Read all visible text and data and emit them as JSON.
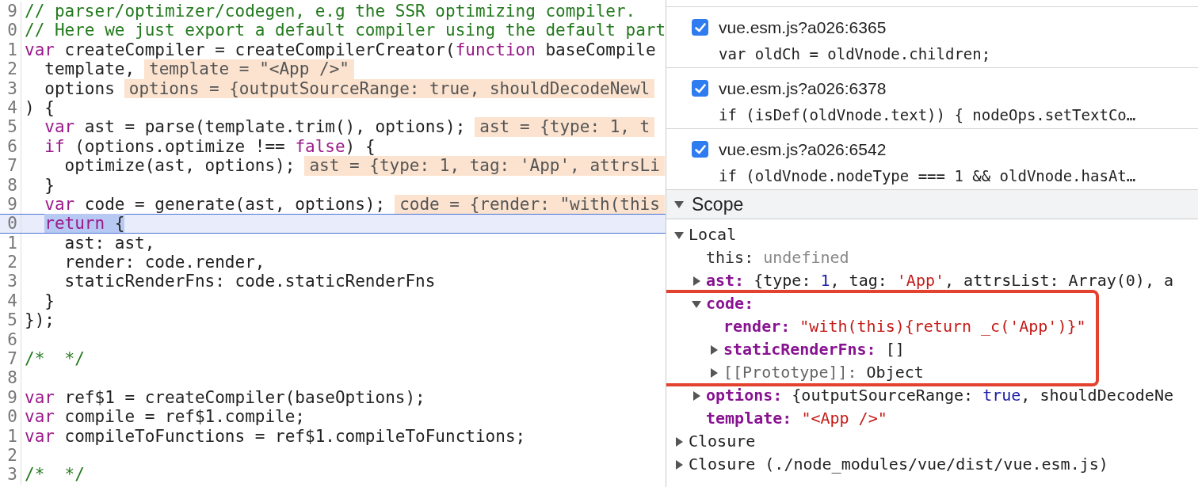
{
  "editor": {
    "lines": [
      {
        "number": "9",
        "current": false,
        "segments": [
          {
            "kind": "comment",
            "text": "// parser/optimizer/codegen, e.g the SSR optimizing compiler."
          }
        ]
      },
      {
        "number": "0",
        "current": false,
        "segments": [
          {
            "kind": "comment",
            "text": "// Here we just export a default compiler using the default part"
          }
        ]
      },
      {
        "number": "1",
        "current": false,
        "segments": [
          {
            "kind": "keyword",
            "text": "var"
          },
          {
            "kind": "plain",
            "text": " createCompiler = createCompilerCreator("
          },
          {
            "kind": "keyword",
            "text": "function"
          },
          {
            "kind": "plain",
            "text": " baseCompile"
          }
        ]
      },
      {
        "number": "2",
        "current": false,
        "segments": [
          {
            "kind": "plain",
            "text": "  template,"
          }
        ],
        "hint": "template = \"<App />\""
      },
      {
        "number": "3",
        "current": false,
        "segments": [
          {
            "kind": "plain",
            "text": "  options"
          }
        ],
        "hint": "options = {outputSourceRange: true, shouldDecodeNewl"
      },
      {
        "number": "4",
        "current": false,
        "segments": [
          {
            "kind": "plain",
            "text": ") {"
          }
        ]
      },
      {
        "number": "5",
        "current": false,
        "segments": [
          {
            "kind": "keyword",
            "text": "  var"
          },
          {
            "kind": "plain",
            "text": " ast = parse(template.trim(), options);"
          }
        ],
        "hint": "ast = {type: 1, t"
      },
      {
        "number": "6",
        "current": false,
        "segments": [
          {
            "kind": "keyword",
            "text": "  if"
          },
          {
            "kind": "plain",
            "text": " (options.optimize !== "
          },
          {
            "kind": "keyword",
            "text": "false"
          },
          {
            "kind": "plain",
            "text": ") {"
          }
        ]
      },
      {
        "number": "7",
        "current": false,
        "segments": [
          {
            "kind": "plain",
            "text": "    optimize(ast, options);"
          }
        ],
        "hint": "ast = {type: 1, tag: 'App', attrsLi"
      },
      {
        "number": "8",
        "current": false,
        "segments": [
          {
            "kind": "plain",
            "text": "  }"
          }
        ]
      },
      {
        "number": "9",
        "current": false,
        "segments": [
          {
            "kind": "keyword",
            "text": "  var"
          },
          {
            "kind": "plain",
            "text": " code = generate(ast, options);"
          }
        ],
        "hint": "code = {render: \"with(this"
      },
      {
        "number": "0",
        "current": true,
        "segments": [
          {
            "kind": "keyword",
            "text": "  return"
          },
          {
            "kind": "plain",
            "text": " {"
          }
        ]
      },
      {
        "number": "1",
        "current": false,
        "segments": [
          {
            "kind": "plain",
            "text": "    ast: ast,"
          }
        ]
      },
      {
        "number": "2",
        "current": false,
        "segments": [
          {
            "kind": "plain",
            "text": "    render: code.render,"
          }
        ]
      },
      {
        "number": "3",
        "current": false,
        "segments": [
          {
            "kind": "plain",
            "text": "    staticRenderFns: code.staticRenderFns"
          }
        ]
      },
      {
        "number": "4",
        "current": false,
        "segments": [
          {
            "kind": "plain",
            "text": "  }"
          }
        ]
      },
      {
        "number": "5",
        "current": false,
        "segments": [
          {
            "kind": "plain",
            "text": "});"
          }
        ]
      },
      {
        "number": "6",
        "current": false
      },
      {
        "number": "7",
        "current": false,
        "segments": [
          {
            "kind": "comment",
            "text": "/*  */"
          }
        ]
      },
      {
        "number": "8",
        "current": false
      },
      {
        "number": "9",
        "current": false,
        "segments": [
          {
            "kind": "keyword",
            "text": "var"
          },
          {
            "kind": "plain",
            "text": " ref$1 = createCompiler(baseOptions);"
          }
        ]
      },
      {
        "number": "0",
        "current": false,
        "segments": [
          {
            "kind": "keyword",
            "text": "var"
          },
          {
            "kind": "plain",
            "text": " compile = ref$1.compile;"
          }
        ]
      },
      {
        "number": "1",
        "current": false,
        "segments": [
          {
            "kind": "keyword",
            "text": "var"
          },
          {
            "kind": "plain",
            "text": " compileToFunctions = ref$1.compileToFunctions;"
          }
        ]
      },
      {
        "number": "2",
        "current": false
      },
      {
        "number": "3",
        "current": false,
        "segments": [
          {
            "kind": "comment",
            "text": "/*  */"
          }
        ]
      }
    ]
  },
  "breakpoints": [
    {
      "location": "vue.esm.js?a026:6365",
      "code": "var oldCh = oldVnode.children;",
      "checked": true
    },
    {
      "location": "vue.esm.js?a026:6378",
      "code": "if (isDef(oldVnode.text)) { nodeOps.setTextCo…",
      "checked": true
    },
    {
      "location": "vue.esm.js?a026:6542",
      "code": "if (oldVnode.nodeType === 1 && oldVnode.hasAt…",
      "checked": true
    }
  ],
  "scope": {
    "title": "Scope",
    "expanded": true,
    "nodes": [
      {
        "key": "Local",
        "kind": "group",
        "expanded": true,
        "boxed": false,
        "children": [
          {
            "key": "this:",
            "kind": "plain",
            "boxed": false,
            "value": [
              {
                "kind": "undefined",
                "text": "undefined"
              }
            ]
          },
          {
            "key": "ast:",
            "kind": "prop",
            "expanded": false,
            "boxed": false,
            "value": [
              {
                "kind": "plain",
                "text": "{type: "
              },
              {
                "kind": "number",
                "text": "1"
              },
              {
                "kind": "plain",
                "text": ", tag: "
              },
              {
                "kind": "string",
                "text": "'App'"
              },
              {
                "kind": "plain",
                "text": ", attrsList: Array(0), a"
              }
            ]
          },
          {
            "key": "code:",
            "kind": "prop",
            "expanded": true,
            "boxed": true,
            "children": [
              {
                "key": "render:",
                "kind": "prop",
                "boxed": false,
                "value": [
                  {
                    "kind": "string",
                    "text": "\"with(this){return _c('App')}\""
                  }
                ]
              },
              {
                "key": "staticRenderFns:",
                "kind": "prop",
                "expanded": false,
                "boxed": false,
                "value": [
                  {
                    "kind": "plain",
                    "text": "[]"
                  }
                ]
              },
              {
                "key": "[[Prototype]]:",
                "kind": "internal",
                "expanded": false,
                "boxed": false,
                "value": [
                  {
                    "kind": "plain",
                    "text": "Object"
                  }
                ]
              }
            ]
          },
          {
            "key": "options:",
            "kind": "prop",
            "expanded": false,
            "boxed": false,
            "value": [
              {
                "kind": "plain",
                "text": "{outputSourceRange: "
              },
              {
                "kind": "number",
                "text": "true"
              },
              {
                "kind": "plain",
                "text": ", shouldDecodeNe"
              }
            ]
          },
          {
            "key": "template:",
            "kind": "prop",
            "boxed": false,
            "value": [
              {
                "kind": "string",
                "text": "\"<App />\""
              }
            ]
          }
        ]
      },
      {
        "key": "Closure",
        "kind": "group",
        "expanded": false,
        "boxed": false
      },
      {
        "key": "Closure (./node_modules/vue/dist/vue.esm.js)",
        "kind": "group",
        "expanded": false,
        "boxed": false
      }
    ]
  }
}
